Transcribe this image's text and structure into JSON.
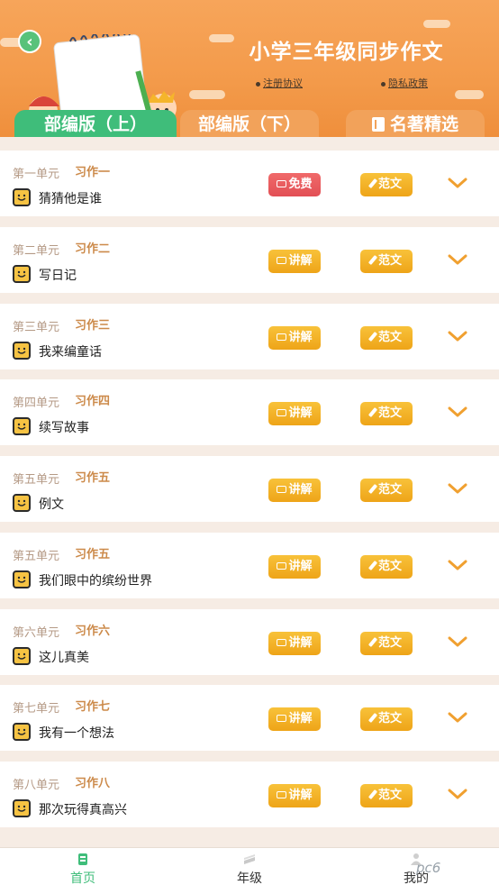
{
  "header": {
    "title": "小学三年级同步作文",
    "links": [
      "注册协议",
      "隐私政策"
    ],
    "back_label": "‹"
  },
  "tabs": [
    {
      "label": "部编版（上）",
      "active": true
    },
    {
      "label": "部编版（下）",
      "active": false
    },
    {
      "label": "名著精选",
      "active": false,
      "icon": "book-icon"
    }
  ],
  "lessons": [
    {
      "unit": "第一单元",
      "exercise": "习作一",
      "topic": "猜猜他是谁",
      "lesson_button": "免费",
      "essay_button": "范文",
      "free": true
    },
    {
      "unit": "第二单元",
      "exercise": "习作二",
      "topic": "写日记",
      "lesson_button": "讲解",
      "essay_button": "范文",
      "free": false
    },
    {
      "unit": "第三单元",
      "exercise": "习作三",
      "topic": "我来编童话",
      "lesson_button": "讲解",
      "essay_button": "范文",
      "free": false
    },
    {
      "unit": "第四单元",
      "exercise": "习作四",
      "topic": "续写故事",
      "lesson_button": "讲解",
      "essay_button": "范文",
      "free": false
    },
    {
      "unit": "第五单元",
      "exercise": "习作五",
      "topic": "例文",
      "lesson_button": "讲解",
      "essay_button": "范文",
      "free": false
    },
    {
      "unit": "第五单元",
      "exercise": "习作五",
      "topic": "我们眼中的缤纷世界",
      "lesson_button": "讲解",
      "essay_button": "范文",
      "free": false
    },
    {
      "unit": "第六单元",
      "exercise": "习作六",
      "topic": "这儿真美",
      "lesson_button": "讲解",
      "essay_button": "范文",
      "free": false
    },
    {
      "unit": "第七单元",
      "exercise": "习作七",
      "topic": "我有一个想法",
      "lesson_button": "讲解",
      "essay_button": "范文",
      "free": false
    },
    {
      "unit": "第八单元",
      "exercise": "习作八",
      "topic": "那次玩得真高兴",
      "lesson_button": "讲解",
      "essay_button": "范文",
      "free": false
    }
  ],
  "bottom_nav": [
    {
      "label": "首页",
      "icon": "home-icon",
      "active": true
    },
    {
      "label": "年级",
      "icon": "books-icon",
      "active": false
    },
    {
      "label": "我的",
      "icon": "user-icon",
      "active": false
    }
  ],
  "watermark": "pc6",
  "colors": {
    "header_orange": "#f39a4a",
    "active_green": "#3fbd7a",
    "button_yellow": "#eea418",
    "free_red": "#e24f55"
  }
}
